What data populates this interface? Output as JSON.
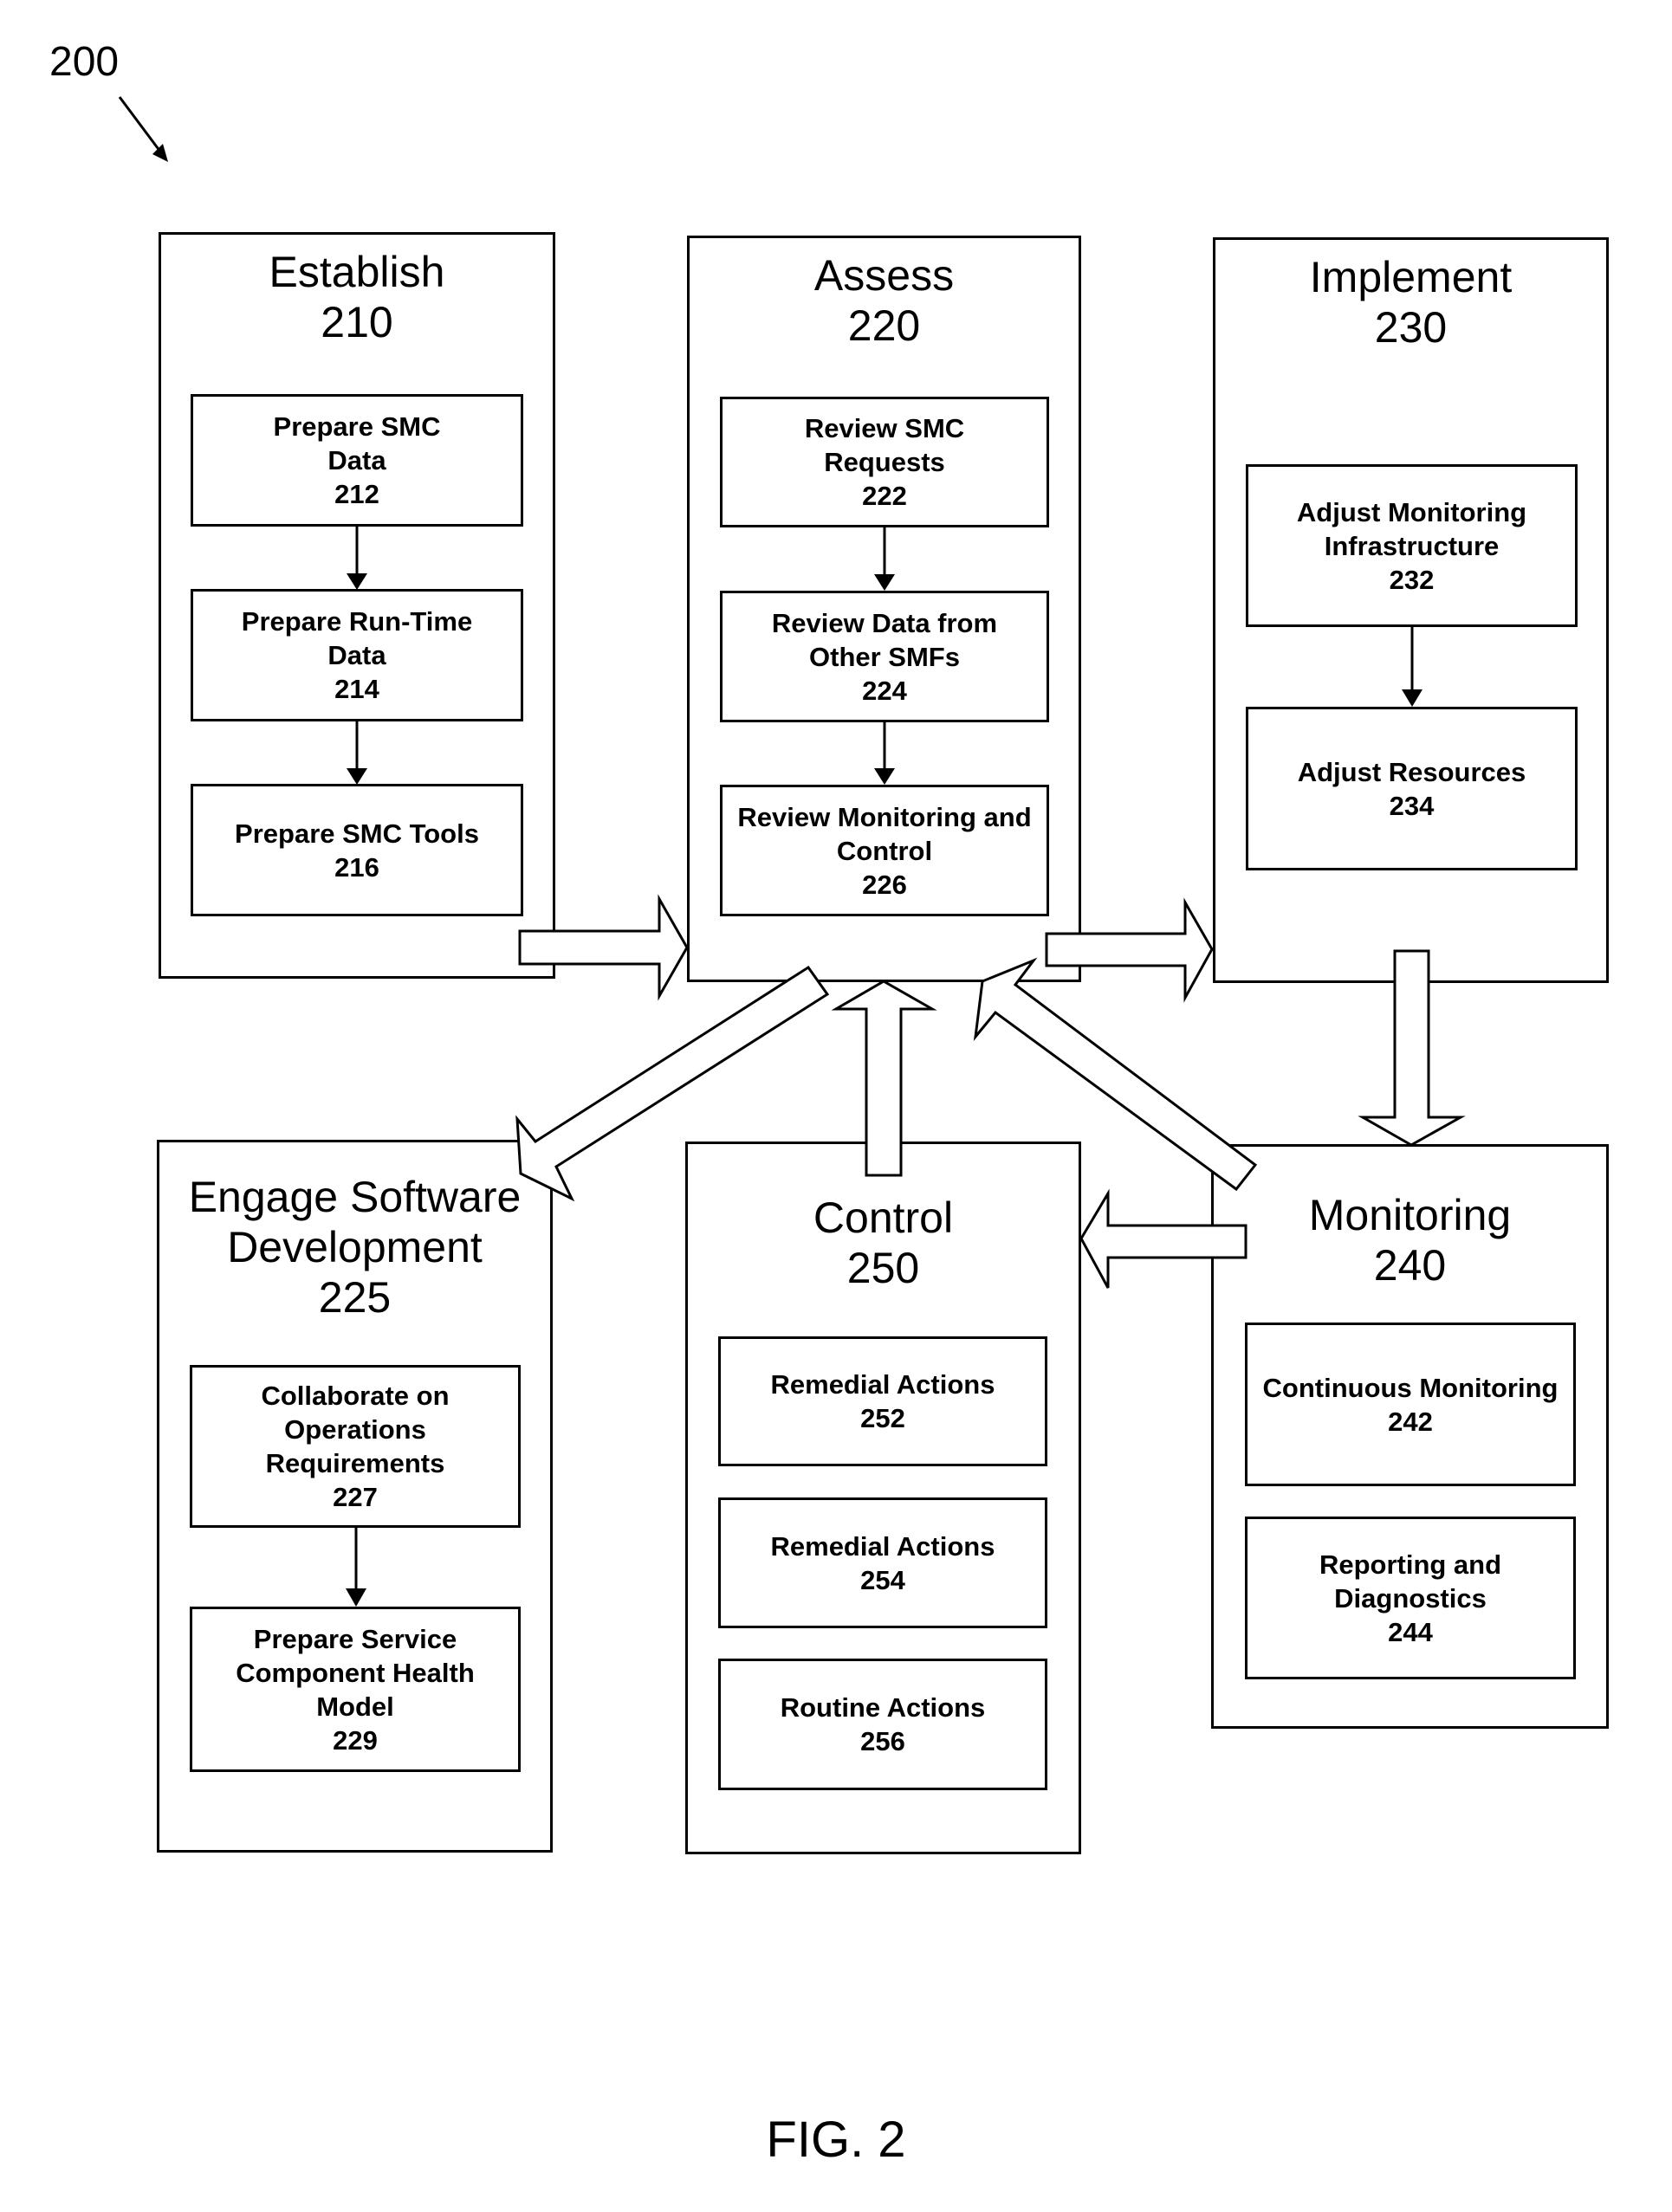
{
  "figure": {
    "reference": "200",
    "caption": "FIG. 2"
  },
  "phases": {
    "establish": {
      "title": "Establish",
      "number": "210",
      "steps": [
        {
          "label": [
            "Prepare SMC",
            "Data"
          ],
          "number": "212"
        },
        {
          "label": [
            "Prepare Run-Time",
            "Data"
          ],
          "number": "214"
        },
        {
          "label": [
            "Prepare SMC Tools"
          ],
          "number": "216"
        }
      ]
    },
    "assess": {
      "title": "Assess",
      "number": "220",
      "steps": [
        {
          "label": [
            "Review SMC",
            "Requests"
          ],
          "number": "222"
        },
        {
          "label": [
            "Review Data from",
            "Other SMFs"
          ],
          "number": "224"
        },
        {
          "label": [
            "Review Monitoring and",
            "Control"
          ],
          "number": "226"
        }
      ]
    },
    "implement": {
      "title": "Implement",
      "number": "230",
      "steps": [
        {
          "label": [
            "Adjust Monitoring",
            "Infrastructure"
          ],
          "number": "232"
        },
        {
          "label": [
            "Adjust Resources"
          ],
          "number": "234"
        }
      ]
    },
    "engage": {
      "title_lines": [
        "Engage Software",
        "Development"
      ],
      "number": "225",
      "steps": [
        {
          "label": [
            "Collaborate on",
            "Operations",
            "Requirements"
          ],
          "number": "227"
        },
        {
          "label": [
            "Prepare Service",
            "Component Health",
            "Model"
          ],
          "number": "229"
        }
      ]
    },
    "control": {
      "title": "Control",
      "number": "250",
      "steps": [
        {
          "label": [
            "Remedial Actions"
          ],
          "number": "252"
        },
        {
          "label": [
            "Remedial Actions"
          ],
          "number": "254"
        },
        {
          "label": [
            "Routine Actions"
          ],
          "number": "256"
        }
      ]
    },
    "monitoring": {
      "title": "Monitoring",
      "number": "240",
      "steps": [
        {
          "label": [
            "Continuous Monitoring"
          ],
          "number": "242"
        },
        {
          "label": [
            "Reporting and",
            "Diagnostics"
          ],
          "number": "244"
        }
      ]
    }
  },
  "flows": [
    {
      "from": "Establish 210",
      "to": "Assess 220"
    },
    {
      "from": "Assess 220",
      "to": "Implement 230"
    },
    {
      "from": "Implement 230",
      "to": "Monitoring 240"
    },
    {
      "from": "Monitoring 240",
      "to": "Control 250"
    },
    {
      "from": "Monitoring 240",
      "to": "Assess 220"
    },
    {
      "from": "Control 250",
      "to": "Assess 220"
    },
    {
      "from": "Assess 220",
      "to": "Engage Software Development 225"
    }
  ]
}
